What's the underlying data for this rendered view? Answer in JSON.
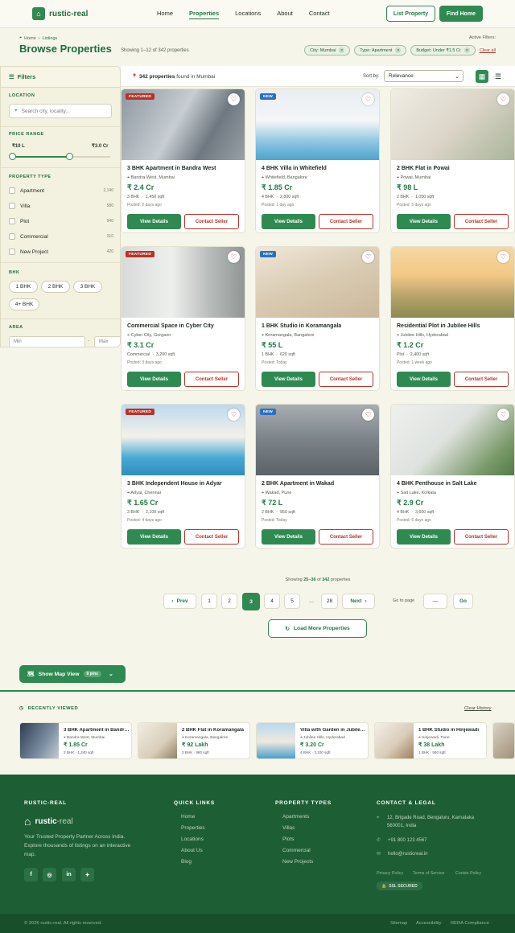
{
  "header": {
    "logo_text": "rustic-real",
    "nav": [
      "Home",
      "Properties",
      "Locations",
      "About",
      "Contact"
    ],
    "active_nav": "Properties",
    "list_property": "List Property",
    "find_home": "Find Home"
  },
  "breadcrumb": {
    "home": "Home",
    "sep": "›",
    "current": "Listings"
  },
  "page": {
    "title": "Browse Properties",
    "subtitle": "Showing 1–12 of 342 properties",
    "active_filters_label": "Active Filters:",
    "filters": [
      "City: Mumbai",
      "Type: Apartment",
      "Budget: Under ₹1.5 Cr"
    ],
    "clear_all": "Clear all"
  },
  "sidebar": {
    "title": "Filters",
    "location_label": "LOCATION",
    "location_placeholder": "Search city, locality...",
    "price_label": "PRICE RANGE",
    "price_min": "₹10 L",
    "price_max": "₹3.0 Cr",
    "price_range_fraction": [
      0.0,
      0.58
    ],
    "type_label": "PROPERTY TYPE",
    "types": [
      {
        "name": "Apartment",
        "count": "2,140"
      },
      {
        "name": "Villa",
        "count": "580"
      },
      {
        "name": "Plot",
        "count": "940"
      },
      {
        "name": "Commercial",
        "count": "310"
      },
      {
        "name": "New Project",
        "count": "420"
      }
    ],
    "bhk_label": "BHK",
    "bhk": [
      "1 BHK",
      "2 BHK",
      "3 BHK",
      "4+ BHK"
    ],
    "area_label": "AREA",
    "area_min_placeholder": "Min",
    "area_sep": "-",
    "area_max_placeholder": "Max"
  },
  "results": {
    "count": "342",
    "count_word": "properties",
    "found_text": "found in Mumbai",
    "sort_label": "Sort by:",
    "sort_value": "Relevance"
  },
  "cards": [
    {
      "badge": "FEATURED",
      "title": "3 BHK Apartment in Bandra West",
      "location": "Bandra West, Mumbai",
      "price": "₹ 2.4 Cr",
      "spec1": "3 BHK",
      "spec2": "1,450 sqft",
      "posted": "Posted: 2 days ago"
    },
    {
      "badge": "NEW",
      "title": "4 BHK Villa in Whitefield",
      "location": "Whitefield, Bangalore",
      "price": "₹ 1.85 Cr",
      "spec1": "4 BHK",
      "spec2": "2,800 sqft",
      "posted": "Posted: 1 day ago"
    },
    {
      "badge": "",
      "title": "2 BHK Flat in Powai",
      "location": "Powai, Mumbai",
      "price": "₹ 98 L",
      "spec1": "2 BHK",
      "spec2": "1,050 sqft",
      "posted": "Posted: 5 days ago"
    },
    {
      "badge": "FEATURED",
      "title": "Commercial Space in Cyber City",
      "location": "Cyber City, Gurgaon",
      "price": "₹ 3.1 Cr",
      "spec1": "Commercial",
      "spec2": "3,200 sqft",
      "posted": "Posted: 3 days ago"
    },
    {
      "badge": "NEW",
      "title": "1 BHK Studio in Koramangala",
      "location": "Koramangala, Bangalore",
      "price": "₹ 55 L",
      "spec1": "1 BHK",
      "spec2": "620 sqft",
      "posted": "Posted: Today"
    },
    {
      "badge": "",
      "title": "Residential Plot in Jubilee Hills",
      "location": "Jubilee Hills, Hyderabad",
      "price": "₹ 1.2 Cr",
      "spec1": "Plot",
      "spec2": "2,400 sqft",
      "posted": "Posted: 1 week ago"
    },
    {
      "badge": "FEATURED",
      "title": "3 BHK Independent House in Adyar",
      "location": "Adyar, Chennai",
      "price": "₹ 1.65 Cr",
      "spec1": "3 BHK",
      "spec2": "2,100 sqft",
      "posted": "Posted: 4 days ago"
    },
    {
      "badge": "NEW",
      "title": "2 BHK Apartment in Wakad",
      "location": "Wakad, Pune",
      "price": "₹ 72 L",
      "spec1": "2 BHK",
      "spec2": "950 sqft",
      "posted": "Posted: Today"
    },
    {
      "badge": "",
      "title": "4 BHK Penthouse in Salt Lake",
      "location": "Salt Lake, Kolkata",
      "price": "₹ 2.9 Cr",
      "spec1": "4 BHK",
      "spec2": "3,600 sqft",
      "posted": "Posted: 6 days ago"
    }
  ],
  "card_labels": {
    "view": "View Details",
    "contact": "Contact Seller"
  },
  "pagination": {
    "showing_pre": "Showing",
    "showing_range": "25–36",
    "showing_of": "of",
    "showing_total": "342",
    "showing_post": "properties",
    "prev": "Prev",
    "pages": [
      "1",
      "2",
      "3",
      "4",
      "5",
      "…",
      "28"
    ],
    "current": "3",
    "next": "Next",
    "goto_label": "Go to page",
    "goto_placeholder": "—",
    "go": "Go",
    "load_more": "Load More Properties"
  },
  "map_button": {
    "label": "Show Map View",
    "pins": "9 pins"
  },
  "recently_viewed": {
    "title": "RECENTLY VIEWED",
    "clear": "Clear History",
    "items": [
      {
        "title": "3 BHK Apartment in Bandra West",
        "location": "Bandra West, Mumbai",
        "price": "₹ 1.85 Cr",
        "spec": "3 BHK · 1,240 sqft"
      },
      {
        "title": "2 BHK Flat in Koramangala",
        "location": "Koramangala, Bangalore",
        "price": "₹ 92 Lakh",
        "spec": "2 BHK · 980 sqft"
      },
      {
        "title": "Villa with Garden in Jubilee Hills",
        "location": "Jubilee Hills, Hyderabad",
        "price": "₹ 3.20 Cr",
        "spec": "4 BHK · 3,100 sqft"
      },
      {
        "title": "1 BHK Studio in Hinjewadi",
        "location": "Hinjewadi, Pune",
        "price": "₹ 38 Lakh",
        "spec": "1 BHK · 560 sqft"
      }
    ]
  },
  "footer": {
    "brand_heading": "RUSTIC-REAL",
    "brand_name": "rustic",
    "brand_suffix": "-real",
    "description": "Your Trusted Property Partner Across India. Explore thousands of listings on an interactive map.",
    "quick_links_heading": "QUICK LINKS",
    "quick_links": [
      "Home",
      "Properties",
      "Locations",
      "About Us",
      "Blog"
    ],
    "types_heading": "PROPERTY TYPES",
    "types": [
      "Apartments",
      "Villas",
      "Plots",
      "Commercial",
      "New Projects"
    ],
    "contact_heading": "CONTACT & LEGAL",
    "address": "12, Brigade Road, Bengaluru, Karnataka 560001, India",
    "phone": "+91 800 123 4567",
    "email": "hello@rusticreal.in",
    "legal": [
      "Privacy Policy",
      "Terms of Service",
      "Cookie Policy"
    ],
    "ssl": "SSL SECURED",
    "copyright": "© 2026 rustic-real. All rights reserved.",
    "bottom_links": [
      "Sitemap",
      "Accessibility",
      "RERA Compliance"
    ]
  },
  "colors": {
    "brand": "#2f8a51",
    "brand_dark": "#1e5e34",
    "accent_red": "#b93227",
    "new_blue": "#2a70c4",
    "background": "#f6f5ea"
  }
}
